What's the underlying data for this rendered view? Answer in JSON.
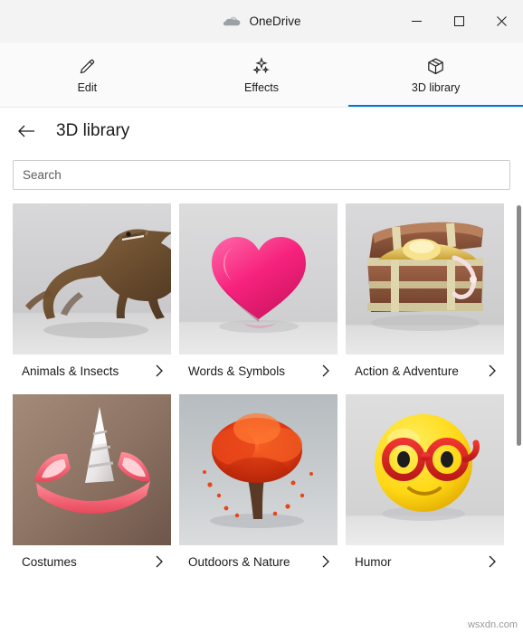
{
  "window": {
    "title": "OneDrive",
    "icon": "cloud-icon",
    "controls": {
      "minimize": "─",
      "maximize": "❑",
      "close": "✕"
    }
  },
  "tabs": [
    {
      "label": "Edit",
      "icon": "pencil-icon",
      "active": false
    },
    {
      "label": "Effects",
      "icon": "sparkles-icon",
      "active": false
    },
    {
      "label": "3D library",
      "icon": "cube-icon",
      "active": true
    }
  ],
  "header": {
    "back": "back-arrow-icon",
    "title": "3D library"
  },
  "search": {
    "placeholder": "Search",
    "value": ""
  },
  "grid": {
    "chevron": "›",
    "cards": [
      {
        "label": "Animals & Insects",
        "art": "dinosaur"
      },
      {
        "label": "Words & Symbols",
        "art": "heart"
      },
      {
        "label": "Action & Adventure",
        "art": "treasure"
      },
      {
        "label": "Costumes",
        "art": "unicorn"
      },
      {
        "label": "Outdoors & Nature",
        "art": "tree"
      },
      {
        "label": "Humor",
        "art": "emoji"
      }
    ]
  },
  "watermark": "wsxdn.com",
  "colors": {
    "accent": "#0078d4",
    "titlebar": "#f3f3f3",
    "tabbar": "#fafafa",
    "text": "#1b1b1b"
  }
}
